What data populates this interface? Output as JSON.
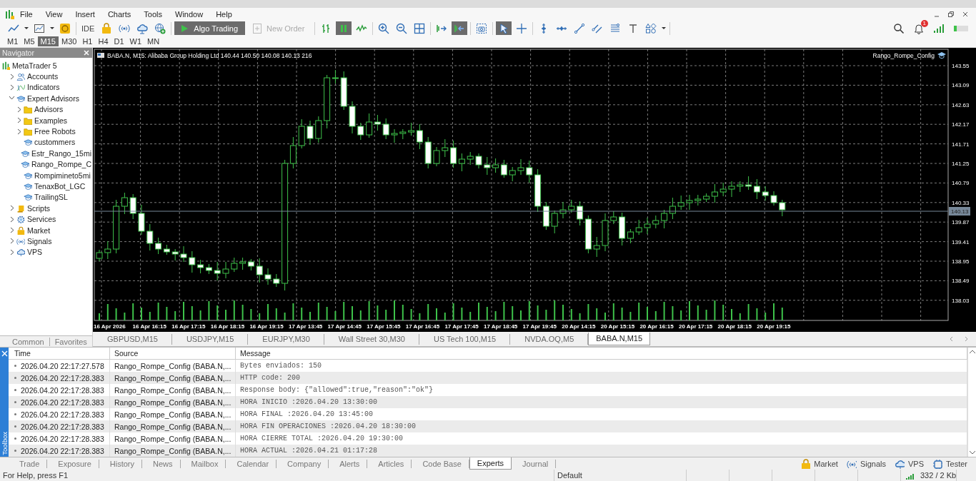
{
  "menu": [
    "File",
    "View",
    "Insert",
    "Charts",
    "Tools",
    "Window",
    "Help"
  ],
  "toolbar": {
    "groups": [
      [
        {
          "on": false
        },
        {
          "on": false
        },
        {
          "on": false
        }
      ],
      [
        {
          "label": "IDE",
          "on": false
        },
        {
          "on": false
        },
        {
          "on": false
        },
        {
          "on": false
        },
        {
          "on": false
        }
      ],
      [
        {
          "label": "Algo Trading",
          "on": true
        },
        {
          "label": "New Order",
          "on": false,
          "disabled": true
        }
      ],
      [
        {
          "on": false
        },
        {
          "on": true
        },
        {
          "on": false
        }
      ],
      [
        {
          "on": false
        },
        {
          "on": false
        },
        {
          "on": false
        }
      ],
      [
        {
          "on": false
        },
        {
          "on": true
        }
      ],
      [
        {
          "on": false
        }
      ],
      [
        {
          "on": true
        },
        {
          "on": false
        }
      ],
      [
        {
          "on": false
        },
        {
          "on": false
        },
        {
          "on": false
        },
        {
          "on": false
        },
        {
          "on": false
        },
        {
          "on": false
        },
        {
          "on": false
        }
      ]
    ],
    "notification_badge": "1"
  },
  "timeframes": [
    {
      "label": "M1",
      "selected": false
    },
    {
      "label": "M5",
      "selected": false
    },
    {
      "label": "M15",
      "selected": true
    },
    {
      "label": "M30",
      "selected": false
    },
    {
      "label": "H1",
      "selected": false
    },
    {
      "label": "H4",
      "selected": false
    },
    {
      "label": "D1",
      "selected": false
    },
    {
      "label": "W1",
      "selected": false
    },
    {
      "label": "MN",
      "selected": false
    }
  ],
  "navigator": {
    "title": "Navigator",
    "tree": [
      {
        "label": "MetaTrader 5",
        "kind": "root",
        "children": [
          {
            "label": "Accounts",
            "kind": "category",
            "expanded": false
          },
          {
            "label": "Indicators",
            "kind": "category",
            "expanded": false
          },
          {
            "label": "Expert Advisors",
            "kind": "category",
            "expanded": true,
            "children": [
              {
                "label": "Advisors",
                "kind": "folder",
                "expanded": false
              },
              {
                "label": "Examples",
                "kind": "folder",
                "expanded": false
              },
              {
                "label": "Free Robots",
                "kind": "folder",
                "expanded": false
              },
              {
                "label": "custommers",
                "kind": "expert"
              },
              {
                "label": "Estr_Rango_15mi",
                "kind": "expert"
              },
              {
                "label": "Rango_Rompe_C",
                "kind": "expert"
              },
              {
                "label": "Rompimineto5mi",
                "kind": "expert"
              },
              {
                "label": "TenaxBot_LGC",
                "kind": "expert"
              },
              {
                "label": "TrailingSL",
                "kind": "expert"
              }
            ]
          },
          {
            "label": "Scripts",
            "kind": "category",
            "expanded": false
          },
          {
            "label": "Services",
            "kind": "category",
            "expanded": false
          },
          {
            "label": "Market",
            "kind": "category",
            "expanded": false
          },
          {
            "label": "Signals",
            "kind": "category",
            "expanded": false
          },
          {
            "label": "VPS",
            "kind": "category",
            "expanded": false
          }
        ]
      }
    ],
    "tabs": [
      {
        "label": "Common",
        "selected": false
      },
      {
        "label": "Favorites",
        "selected": false
      }
    ]
  },
  "chart": {
    "header": "BABA.N, M15:  Alibaba Group Holding Ltd  140.44 140.50 140.08 140.13  216",
    "expert": "Rango_Rompe_Config",
    "price_ticks": [
      "143.55",
      "143.09",
      "142.63",
      "142.17",
      "141.71",
      "141.25",
      "140.79",
      "140.33",
      "139.87",
      "139.41",
      "138.95",
      "138.49",
      "138.03"
    ],
    "current_price": "140.13",
    "time_ticks": [
      "16 Apr 2026",
      "16 Apr 16:15",
      "16 Apr 17:15",
      "16 Apr 18:15",
      "16 Apr 19:15",
      "17 Apr 13:45",
      "17 Apr 14:45",
      "17 Apr 15:45",
      "17 Apr 16:45",
      "17 Apr 17:45",
      "17 Apr 18:45",
      "17 Apr 19:45",
      "20 Apr 14:15",
      "20 Apr 15:15",
      "20 Apr 16:15",
      "20 Apr 17:15",
      "20 Apr 18:15",
      "20 Apr 19:15"
    ]
  },
  "chart_tabs": [
    {
      "label": "GBPUSD,M15",
      "selected": false
    },
    {
      "label": "USDJPY,M15",
      "selected": false
    },
    {
      "label": "EURJPY,M30",
      "selected": false
    },
    {
      "label": "Wall Street 30,M30",
      "selected": false
    },
    {
      "label": "US Tech 100,M15",
      "selected": false
    },
    {
      "label": "NVDA.OQ,M5",
      "selected": false
    },
    {
      "label": "BABA.N,M15",
      "selected": true
    }
  ],
  "toolbox": {
    "title": "Toolbox",
    "columns": [
      "Time",
      "Source",
      "Message"
    ],
    "rows": [
      {
        "time": "2026.04.20 22:17:27.578",
        "source": "Rango_Rompe_Config (BABA.N,...",
        "message": "Bytes enviados: 150"
      },
      {
        "time": "2026.04.20 22:17:28.383",
        "source": "Rango_Rompe_Config (BABA.N,...",
        "message": "HTTP code: 200"
      },
      {
        "time": "2026.04.20 22:17:28.383",
        "source": "Rango_Rompe_Config (BABA.N,...",
        "message": "Response body: {\"allowed\":true,\"reason\":\"ok\"}"
      },
      {
        "time": "2026.04.20 22:17:28.383",
        "source": "Rango_Rompe_Config (BABA.N,...",
        "message": "HORA INICIO :2026.04.20 13:30:00"
      },
      {
        "time": "2026.04.20 22:17:28.383",
        "source": "Rango_Rompe_Config (BABA.N,...",
        "message": "HORA FINAL :2026.04.20 13:45:00"
      },
      {
        "time": "2026.04.20 22:17:28.383",
        "source": "Rango_Rompe_Config (BABA.N,...",
        "message": "HORA FIN OPERACIONES :2026.04.20 18:30:00"
      },
      {
        "time": "2026.04.20 22:17:28.383",
        "source": "Rango_Rompe_Config (BABA.N,...",
        "message": "HORA CIERRE TOTAL :2026.04.20 19:30:00"
      },
      {
        "time": "2026.04.20 22:17:28.383",
        "source": "Rango_Rompe_Config (BABA.N,...",
        "message": "HORA ACTUAL :2026.04.21 01:17:28"
      }
    ],
    "tabs": [
      {
        "label": "Trade",
        "selected": false
      },
      {
        "label": "Exposure",
        "selected": false
      },
      {
        "label": "History",
        "selected": false
      },
      {
        "label": "News",
        "selected": false
      },
      {
        "label": "Mailbox",
        "selected": false
      },
      {
        "label": "Calendar",
        "selected": false
      },
      {
        "label": "Company",
        "selected": false
      },
      {
        "label": "Alerts",
        "selected": false
      },
      {
        "label": "Articles",
        "selected": false
      },
      {
        "label": "Code Base",
        "selected": false
      },
      {
        "label": "Experts",
        "selected": true
      },
      {
        "label": "Journal",
        "selected": false
      }
    ],
    "side_links": [
      "Market",
      "Signals",
      "VPS",
      "Tester"
    ]
  },
  "status_bar": {
    "help": "For Help, press F1",
    "profile": "Default",
    "traffic": "332 / 2 Kb"
  }
}
